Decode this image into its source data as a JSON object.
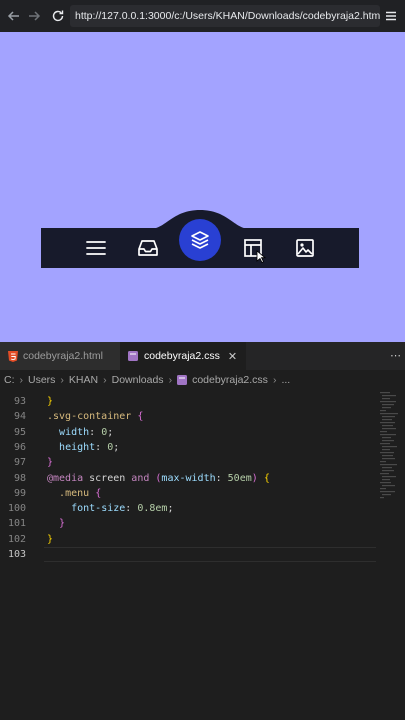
{
  "browser": {
    "url": "http://127.0.0.1:3000/c:/Users/KHAN/Downloads/codebyraja2.html"
  },
  "preview": {
    "background": "#a3a3ff",
    "nav_color": "#171a2b",
    "accent": "#2940d3",
    "icons": [
      "menu-icon",
      "inbox-icon",
      "layers-icon",
      "layout-icon",
      "image-icon"
    ]
  },
  "editor": {
    "tabs": [
      {
        "label": "codebyraja2.html",
        "active": false
      },
      {
        "label": "codebyraja2.css",
        "active": true
      }
    ],
    "breadcrumb": [
      "C:",
      "Users",
      "KHAN",
      "Downloads",
      "codebyraja2.css",
      "..."
    ],
    "lines": [
      {
        "n": "93",
        "tokens": [
          {
            "t": "}",
            "c": "#ffd700"
          }
        ]
      },
      {
        "n": "94",
        "tokens": [
          {
            "t": ".svg-container",
            "c": "#d7ba7d"
          },
          {
            "t": " ",
            "c": "#d4d4d4"
          },
          {
            "t": "{",
            "c": "#da70d6"
          }
        ]
      },
      {
        "n": "95",
        "tokens": [
          {
            "t": "  ",
            "c": "#d4d4d4"
          },
          {
            "t": "width",
            "c": "#9cdcfe"
          },
          {
            "t": ": ",
            "c": "#d4d4d4"
          },
          {
            "t": "0",
            "c": "#b5cea8"
          },
          {
            "t": ";",
            "c": "#d4d4d4"
          }
        ]
      },
      {
        "n": "96",
        "tokens": [
          {
            "t": "  ",
            "c": "#d4d4d4"
          },
          {
            "t": "height",
            "c": "#9cdcfe"
          },
          {
            "t": ": ",
            "c": "#d4d4d4"
          },
          {
            "t": "0",
            "c": "#b5cea8"
          },
          {
            "t": ";",
            "c": "#d4d4d4"
          }
        ]
      },
      {
        "n": "97",
        "tokens": [
          {
            "t": "}",
            "c": "#da70d6"
          }
        ]
      },
      {
        "n": "98",
        "tokens": [
          {
            "t": "@media",
            "c": "#c586c0"
          },
          {
            "t": " screen ",
            "c": "#d4d4d4"
          },
          {
            "t": "and",
            "c": "#c586c0"
          },
          {
            "t": " ",
            "c": "#d4d4d4"
          },
          {
            "t": "(",
            "c": "#da70d6"
          },
          {
            "t": "max-width",
            "c": "#9cdcfe"
          },
          {
            "t": ": ",
            "c": "#d4d4d4"
          },
          {
            "t": "50em",
            "c": "#b5cea8"
          },
          {
            "t": ")",
            "c": "#da70d6"
          },
          {
            "t": " ",
            "c": "#d4d4d4"
          },
          {
            "t": "{",
            "c": "#ffd700"
          }
        ]
      },
      {
        "n": "99",
        "tokens": [
          {
            "t": "  ",
            "c": "#d4d4d4"
          },
          {
            "t": ".menu",
            "c": "#d7ba7d"
          },
          {
            "t": " ",
            "c": "#d4d4d4"
          },
          {
            "t": "{",
            "c": "#da70d6"
          }
        ]
      },
      {
        "n": "100",
        "tokens": [
          {
            "t": "    ",
            "c": "#d4d4d4"
          },
          {
            "t": "font-size",
            "c": "#9cdcfe"
          },
          {
            "t": ": ",
            "c": "#d4d4d4"
          },
          {
            "t": "0.8em",
            "c": "#b5cea8"
          },
          {
            "t": ";",
            "c": "#d4d4d4"
          }
        ]
      },
      {
        "n": "101",
        "tokens": [
          {
            "t": "  ",
            "c": "#d4d4d4"
          },
          {
            "t": "}",
            "c": "#da70d6"
          }
        ]
      },
      {
        "n": "102",
        "tokens": [
          {
            "t": "}",
            "c": "#ffd700"
          }
        ]
      },
      {
        "n": "103",
        "tokens": [],
        "current": true
      }
    ]
  }
}
